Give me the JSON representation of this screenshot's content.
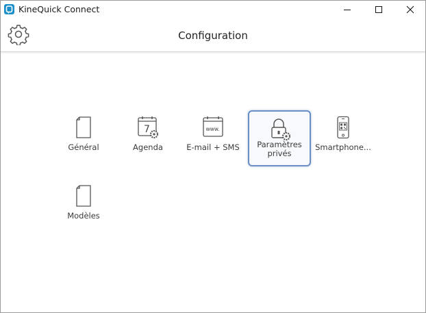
{
  "window": {
    "app_title": "KineQuick Connect",
    "controls": [
      "minimize-icon",
      "maximize-icon",
      "close-icon"
    ]
  },
  "header": {
    "title": "Configuration",
    "settings_icon": "gear-icon"
  },
  "tiles": [
    {
      "label": "Général",
      "icon": "document-icon",
      "selected": false
    },
    {
      "label": "Agenda",
      "icon": "calendar-gear-icon",
      "calendar_day": "7",
      "selected": false
    },
    {
      "label": "E-mail + SMS",
      "icon": "web-calendar-icon",
      "icon_text": "www.",
      "selected": false
    },
    {
      "label": "Paramètres\nprivés",
      "icon": "lock-gear-icon",
      "selected": true
    },
    {
      "label": "Smartphone...",
      "icon": "smartphone-qr-icon",
      "selected": false
    },
    {
      "label": "Modèles",
      "icon": "document-icon",
      "selected": false
    }
  ],
  "colors": {
    "app_icon": "#1a8fc9",
    "selection_border": "#6b8fc4",
    "icon_stroke": "#555555"
  }
}
